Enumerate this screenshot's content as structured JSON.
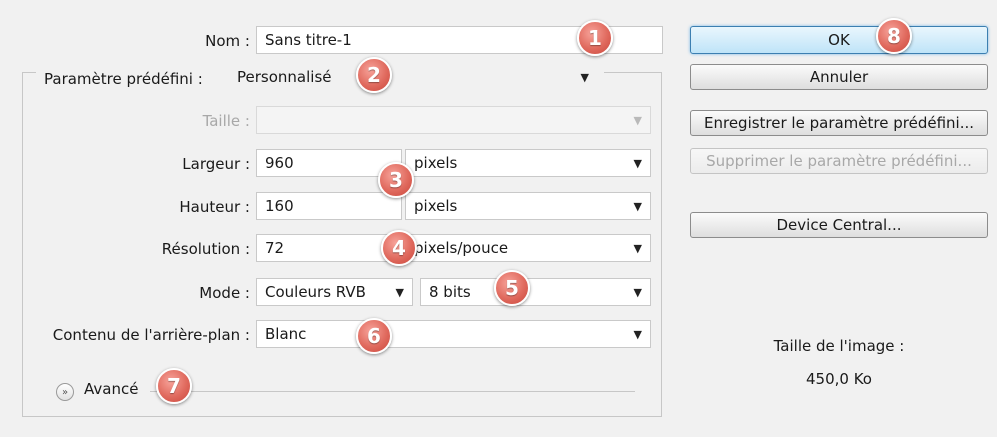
{
  "form": {
    "name": {
      "label": "Nom :",
      "value": "Sans titre-1"
    },
    "preset": {
      "label": "Paramètre prédéfini :",
      "value": "Personnalisé"
    },
    "size": {
      "label": "Taille :",
      "value": ""
    },
    "width": {
      "label": "Largeur :",
      "value": "960",
      "unit": "pixels"
    },
    "height": {
      "label": "Hauteur :",
      "value": "160",
      "unit": "pixels"
    },
    "resolution": {
      "label": "Résolution :",
      "value": "72",
      "unit": "pixels/pouce"
    },
    "mode": {
      "label": "Mode :",
      "value": "Couleurs RVB",
      "depth": "8 bits"
    },
    "background": {
      "label": "Contenu de l'arrière-plan :",
      "value": "Blanc"
    },
    "advanced": {
      "label": "Avancé"
    }
  },
  "buttons": {
    "ok": "OK",
    "cancel": "Annuler",
    "save_preset": "Enregistrer le paramètre prédéfini...",
    "delete_preset": "Supprimer le paramètre prédéfini...",
    "device_central": "Device Central..."
  },
  "image_size": {
    "label": "Taille de l'image :",
    "value": "450,0 Ko"
  },
  "badges": [
    "1",
    "2",
    "3",
    "4",
    "5",
    "6",
    "7",
    "8"
  ],
  "icons": {
    "caret": "▼",
    "expander": "»"
  }
}
